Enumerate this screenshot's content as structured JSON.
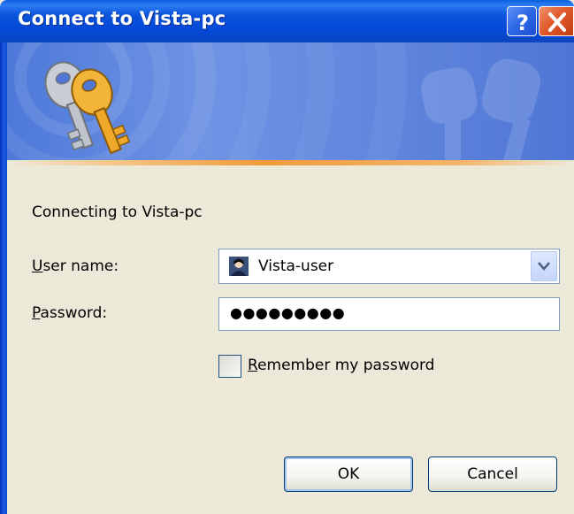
{
  "window": {
    "title": "Connect to Vista-pc",
    "help_glyph": "?",
    "close_glyph": "✕"
  },
  "banner": {
    "icon": "keys-icon"
  },
  "body": {
    "connecting_text": "Connecting to Vista-pc",
    "username_label_underlined": "U",
    "username_label_rest": "ser name:",
    "username_value": "Vista-user",
    "password_label_underlined": "P",
    "password_label_rest": "assword:",
    "password_value": "●●●●●●●●●",
    "remember_underlined": "R",
    "remember_rest": "emember my password",
    "remember_checked": false
  },
  "buttons": {
    "ok": "OK",
    "cancel": "Cancel"
  },
  "colors": {
    "titlebar": "#0449D8",
    "dialog_bg": "#ECE9D8",
    "banner": "#6F94E4",
    "accent_line": "#F39B3A"
  }
}
